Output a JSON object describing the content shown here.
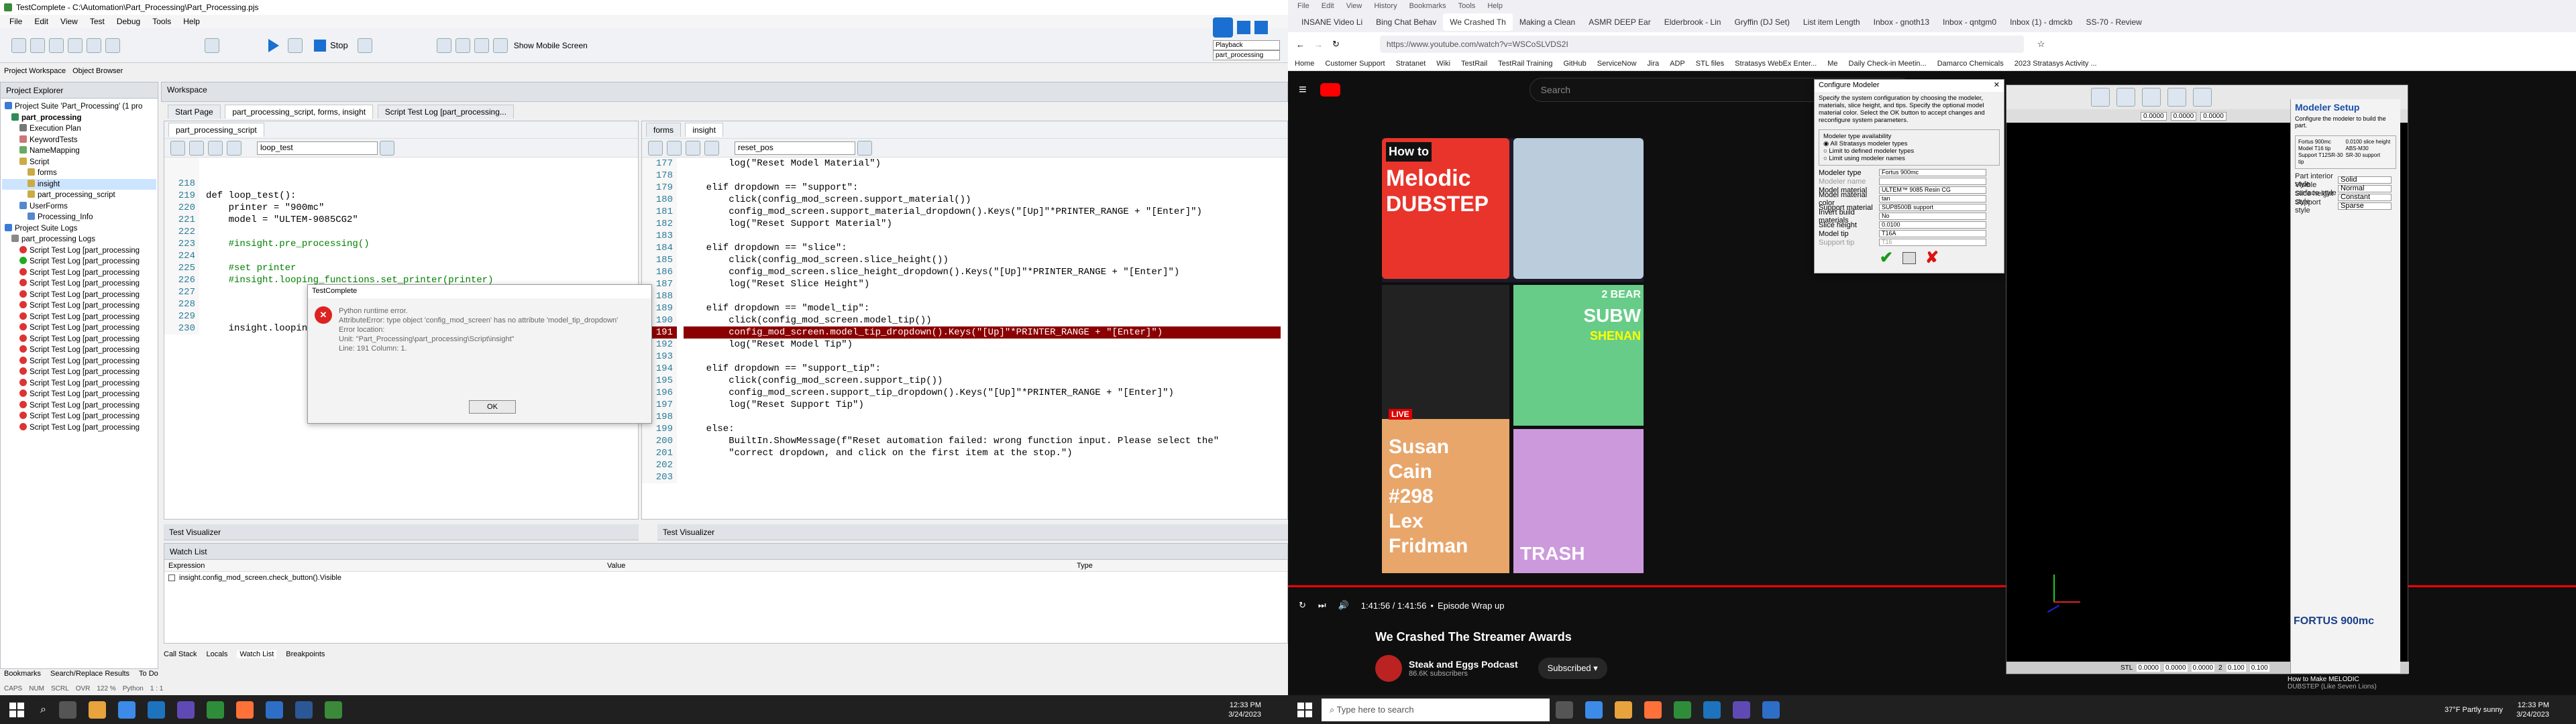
{
  "left": {
    "title": "TestComplete - C:\\Automation\\Part_Processing\\Part_Processing.pjs",
    "menu": [
      "File",
      "Edit",
      "View",
      "Test",
      "Debug",
      "Tools",
      "Help"
    ],
    "toolbar_stop": "Stop",
    "toolbar_mobile": "Show Mobile Screen",
    "playback_label": "Playback",
    "playback_sub": "part_processing",
    "workspace_tabs": [
      "Project Workspace",
      "Object Browser"
    ],
    "explorer_title": "Project Explorer",
    "tree": [
      "Project Suite 'Part_Processing' (1 pro",
      "part_processing",
      "Execution Plan",
      "KeywordTests",
      "NameMapping",
      "Script",
      "forms",
      "insight",
      "part_processing_script",
      "UserForms",
      "Processing_Info",
      "Project Suite Logs",
      "part_processing Logs",
      "Script Test Log [part_processing",
      "Script Test Log [part_processing",
      "Script Test Log [part_processing",
      "Script Test Log [part_processing",
      "Script Test Log [part_processing",
      "Script Test Log [part_processing",
      "Script Test Log [part_processing",
      "Script Test Log [part_processing",
      "Script Test Log [part_processing",
      "Script Test Log [part_processing",
      "Script Test Log [part_processing",
      "Script Test Log [part_processing",
      "Script Test Log [part_processing",
      "Script Test Log [part_processing",
      "Script Test Log [part_processing",
      "Script Test Log [part_processing",
      "Script Test Log [part_processing"
    ],
    "workspace_title": "Workspace",
    "doc_tabs": [
      "Start Page",
      "part_processing_script, forms, insight",
      "Script Test Log [part_processing..."
    ],
    "left_editor": {
      "tab": "part_processing_script",
      "dropdown": "loop_test",
      "line_numbers": [
        "218",
        "219",
        "220",
        "221",
        "222",
        "223",
        "224",
        "225",
        "226",
        "227",
        "228",
        "229",
        "230"
      ],
      "lines": [
        "",
        "def loop_test():",
        "    printer = \"900mc\"",
        "    model = \"ULTEM-9085CG2\"",
        "",
        "    #insight.pre_processing()",
        "",
        "    #set printer",
        "    #insight.looping_functions.set_printer(printer)",
        "",
        "",
        "",
        "    insight.looping_functions.loop_slicing(printer, model)"
      ]
    },
    "right_editor": {
      "tabs": [
        "forms",
        "insight"
      ],
      "dropdown": "reset_pos",
      "line_numbers": [
        "177",
        "178",
        "179",
        "180",
        "181",
        "182",
        "183",
        "184",
        "185",
        "186",
        "187",
        "188",
        "189",
        "190",
        "191",
        "192",
        "193",
        "194",
        "195",
        "196",
        "197",
        "198",
        "199",
        "200",
        "201",
        "202",
        "203"
      ],
      "lines": [
        "        log(\"Reset Model Material\")",
        "",
        "    elif dropdown == \"support\":",
        "        click(config_mod_screen.support_material())",
        "        config_mod_screen.support_material_dropdown().Keys(\"[Up]\"*PRINTER_RANGE + \"[Enter]\")",
        "        log(\"Reset Support Material\")",
        "",
        "    elif dropdown == \"slice\":",
        "        click(config_mod_screen.slice_height())",
        "        config_mod_screen.slice_height_dropdown().Keys(\"[Up]\"*PRINTER_RANGE + \"[Enter]\")",
        "        log(\"Reset Slice Height\")",
        "",
        "    elif dropdown == \"model_tip\":",
        "        click(config_mod_screen.model_tip())",
        "        config_mod_screen.model_tip_dropdown().Keys(\"[Up]\"*PRINTER_RANGE + \"[Enter]\")",
        "        log(\"Reset Model Tip\")",
        "",
        "    elif dropdown == \"support_tip\":",
        "        click(config_mod_screen.support_tip())",
        "        config_mod_screen.support_tip_dropdown().Keys(\"[Up]\"*PRINTER_RANGE + \"[Enter]\")",
        "        log(\"Reset Support Tip\")",
        "",
        "    else:",
        "        BuiltIn.ShowMessage(f\"Reset automation failed: wrong function input. Please select the\"",
        "        \"correct dropdown, and click on the first item at the stop.\")",
        "",
        ""
      ]
    },
    "error_dialog": {
      "title": "TestComplete",
      "lines": [
        "Python runtime error.",
        "AttributeError: type object 'config_mod_screen' has no attribute 'model_tip_dropdown'",
        "",
        "Error location:",
        "Unit: \"Part_Processing\\part_processing\\Script\\insight\"",
        "Line: 191 Column: 1."
      ],
      "ok": "OK"
    },
    "visualizer": [
      "Test Visualizer",
      "Test Visualizer"
    ],
    "watch": {
      "title": "Watch List",
      "cols": [
        "Expression",
        "Value",
        "Type"
      ],
      "row": "insight.config_mod_screen.check_button().Visible"
    },
    "bottom_tabs": [
      "Call Stack",
      "Locals",
      "Watch List",
      "Breakpoints"
    ],
    "bottom_tabs2": [
      "Bookmarks",
      "Search/Replace Results",
      "To Do"
    ],
    "status": [
      "CAPS",
      "NUM",
      "SCRL",
      "OVR",
      "122 %",
      "Python",
      "1 : 1"
    ],
    "clock": {
      "time": "12:33 PM",
      "date": "3/24/2023"
    }
  },
  "right": {
    "tabs": [
      "INSANE Video Li",
      "Bing Chat Behav",
      "We Crashed Th",
      "Making a Clean",
      "ASMR DEEP Ear",
      "Elderbrook - Lin",
      "Gryffin (DJ Set)",
      "List item Length",
      "Inbox - gnoth13",
      "Inbox - qntgm0",
      "Inbox (1) - dmckb",
      "SS-70 - Review"
    ],
    "menu": [
      "File",
      "Edit",
      "View",
      "History",
      "Bookmarks",
      "Tools",
      "Help"
    ],
    "url": "https://www.youtube.com/watch?v=WSCoSLVDS2I",
    "bookmarks": [
      "Home",
      "Customer Support",
      "Stratanet",
      "Wiki",
      "TestRail",
      "TestRail Training",
      "GitHub",
      "ServiceNow",
      "Jira",
      "ADP",
      "STL files",
      "Stratasys WebEx Enter...",
      "Me",
      "Daily Check-in Meetin...",
      "Damarco Chemicals",
      "2023 Stratasys Activity ..."
    ],
    "search_placeholder": "Search",
    "thumbs": {
      "how_to": "How to",
      "melodic": "Melodic",
      "dubstep": "DUBSTEP",
      "live": "LIVE",
      "susan": "Susan",
      "cain": "Cain",
      "num": "#298",
      "lex": "Lex",
      "fridman": "Fridman",
      "trash": "TRASH",
      "subw": "SUBW",
      "shen": "SHENAN",
      "bear": "2 BEAR"
    },
    "player": {
      "time": "1:41:56 / 1:41:56",
      "chapter": "Episode Wrap up"
    },
    "video_title": "We Crashed The Streamer Awards",
    "channel": "Steak and Eggs Podcast",
    "subs": "86.6K subscribers",
    "subscribed": "Subscribed",
    "config_dialog": {
      "title": "Configure Modeler",
      "desc": "Specify the system configuration by choosing the modeler, materials, slice height, and tips. Specify the optional model material color. Select the OK button to accept changes and reconfigure system parameters.",
      "group": "Modeler type availability",
      "radios": [
        "All Stratasys modeler types",
        "Limit to defined modeler types",
        "Limit using modeler names"
      ],
      "rows": [
        [
          "Modeler type",
          "Fortus 900mc"
        ],
        [
          "Modeler name",
          ""
        ],
        [
          "Model material",
          "ULTEM™ 9085 Resin CG"
        ],
        [
          "Model material color",
          "tan"
        ],
        [
          "Support material",
          "SUP8500B support"
        ],
        [
          "Invert build materials",
          "No"
        ],
        [
          "Slice height",
          "0.0100"
        ],
        [
          "Model tip",
          "T16A"
        ],
        [
          "Support tip",
          "T16"
        ]
      ]
    },
    "modeler_setup": {
      "title": "Modeler Setup",
      "subtitle": "Configure the modeler to build the part.",
      "info": [
        "Fortus 900mc",
        "Model  T16 tip",
        "Support T12SR-30 tip",
        "0.0100 slice height",
        "ABS-M30",
        "SR-30 support"
      ],
      "rows": [
        [
          "Part interior style",
          "Solid"
        ],
        [
          "Visible surface style",
          "Normal"
        ],
        [
          "Slice height style",
          "Constant"
        ],
        [
          "Support style",
          "Sparse"
        ]
      ],
      "coords": [
        "0.0000",
        "0.0000",
        "0.0000"
      ],
      "status_vals": [
        "STL",
        "0.0000",
        "0.0000",
        "0.0000",
        "2",
        "0.100",
        "0.100"
      ],
      "brand": "FORTUS 900mc"
    },
    "side_video": {
      "title": "How to Make MELODIC",
      "sub": "DUBSTEP (Like Seven Lions)"
    },
    "taskbar_search": "Type here to search",
    "weather": "37°F  Partly sunny",
    "clock": {
      "time": "12:33 PM",
      "date": "3/24/2023"
    }
  },
  "colors": {
    "error_line": "#8b0000",
    "yt_red": "#ff0000",
    "accent": "#1f6fd1"
  }
}
